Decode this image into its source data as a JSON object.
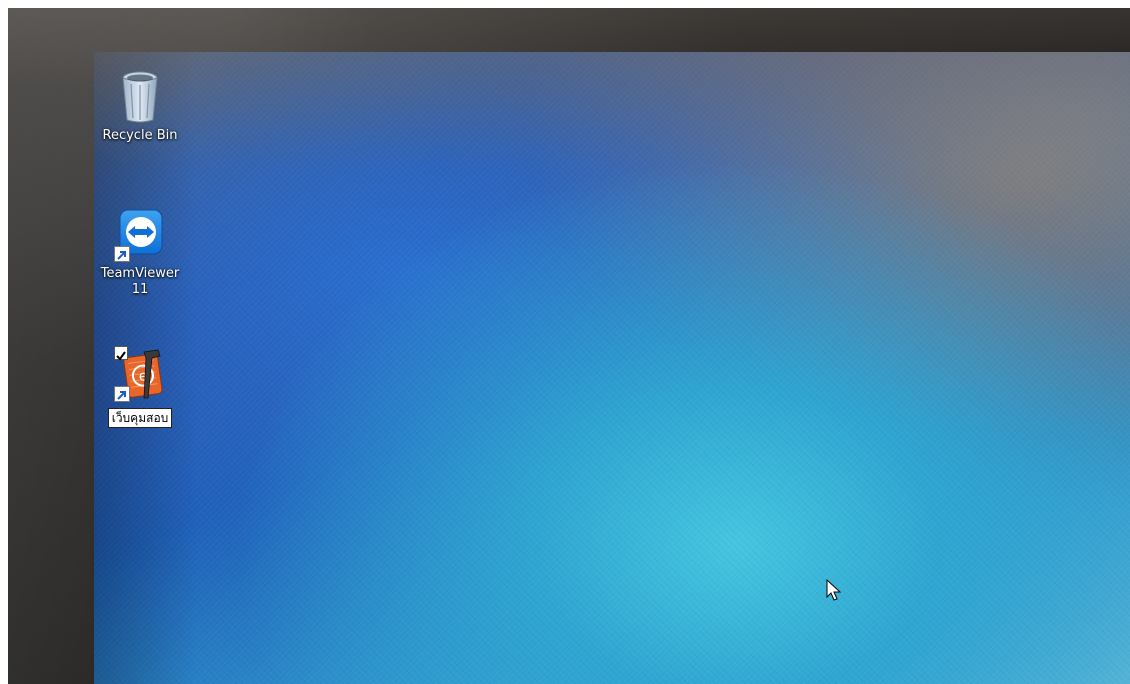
{
  "desktop": {
    "icons": [
      {
        "label": "Recycle Bin",
        "icon": "recycle-bin-icon",
        "shortcut": false,
        "selected": false
      },
      {
        "label": "TeamViewer\n11",
        "icon": "teamviewer-icon",
        "shortcut": true,
        "selected": false
      },
      {
        "label": "เว็บคุมสอบ",
        "icon": "xcode-style-app-icon",
        "shortcut": true,
        "selected": true,
        "renaming": true
      }
    ]
  },
  "colors": {
    "teamviewer_blue": "#0e6fd6",
    "app_orange": "#e8662a",
    "wallpaper_blue": "#1e5fb8",
    "wallpaper_cyan": "#45c6e0"
  },
  "cursor": {
    "icon": "mouse-pointer-icon"
  }
}
